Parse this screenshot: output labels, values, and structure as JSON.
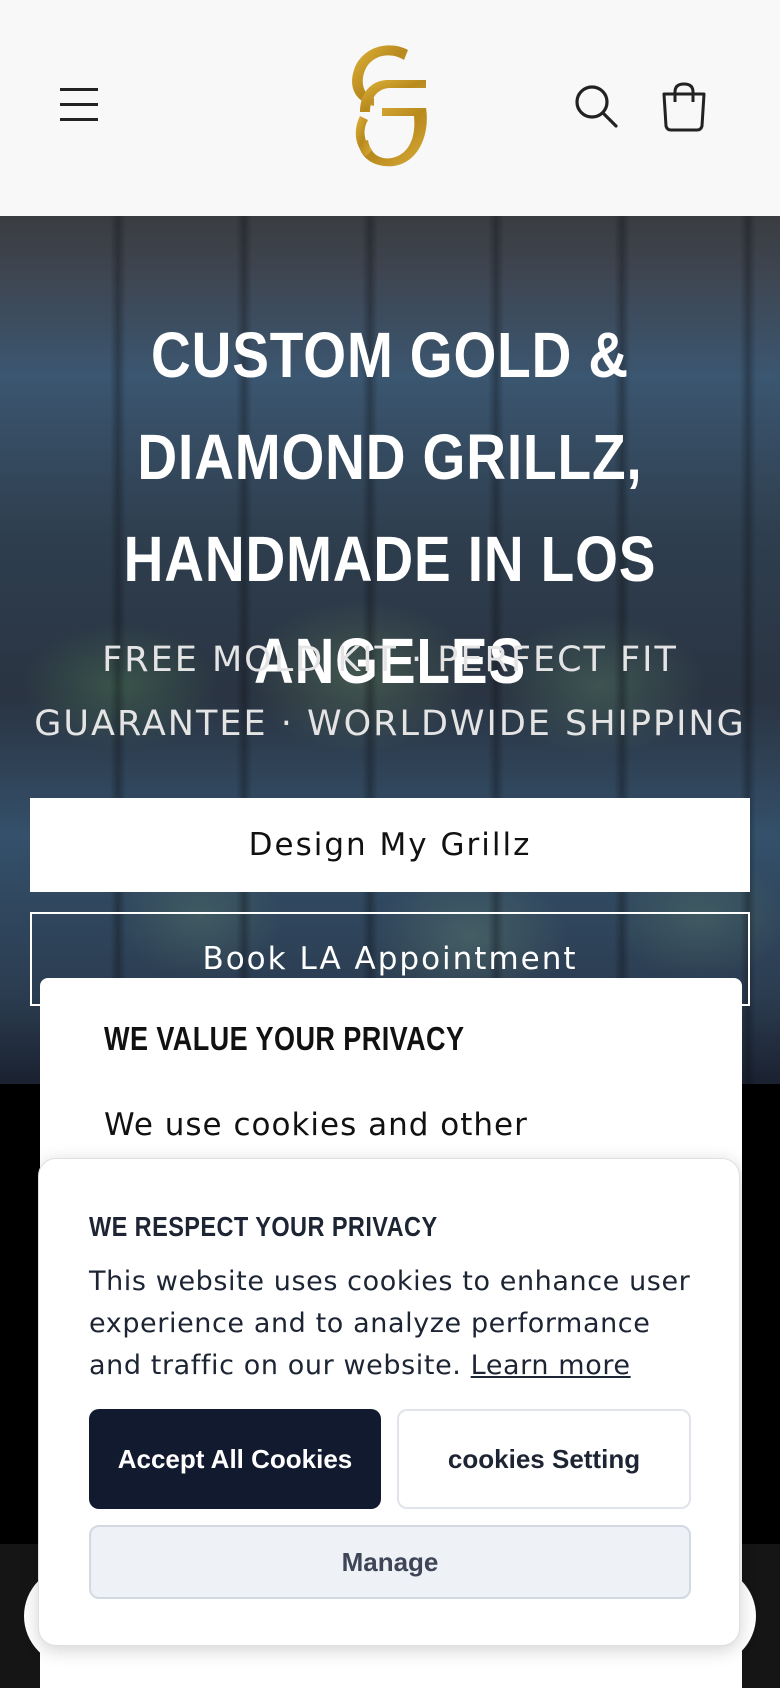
{
  "header": {
    "logo_text": "GG",
    "brand_color": "#c9a227"
  },
  "hero": {
    "title": "CUSTOM GOLD & DIAMOND GRILLZ, HANDMADE IN LOS ANGELES",
    "subtitle": "FREE MOLD KIT · PERFECT FIT GUARANTEE · WORLDWIDE SHIPPING",
    "primary_button": "Design My Grillz",
    "secondary_button": "Book LA Appointment"
  },
  "privacy_dialog": {
    "title": "WE VALUE YOUR PRIVACY",
    "text": "We use cookies and other"
  },
  "consent": {
    "title": "WE RESPECT YOUR PRIVACY",
    "message": "This website uses cookies to enhance user experience and to analyze performance and traffic on our website.",
    "learn_more": "Learn more",
    "accept_label": "Accept All Cookies",
    "settings_label": "cookies Setting",
    "manage_label": "Manage",
    "accent_color": "#111a2e"
  }
}
